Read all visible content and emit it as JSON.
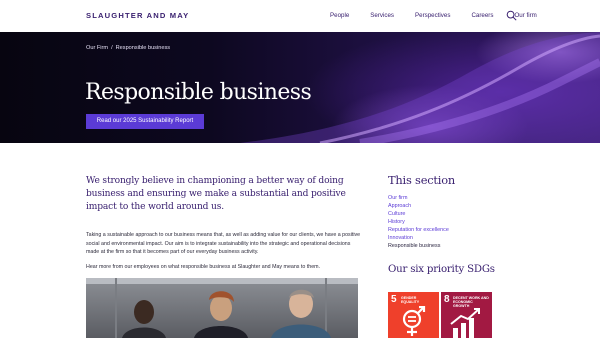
{
  "header": {
    "logo": "SLAUGHTER AND MAY",
    "nav": [
      "People",
      "Services",
      "Perspectives",
      "Careers",
      "Our firm"
    ]
  },
  "hero": {
    "breadcrumb": [
      "Our Firm",
      "Responsible business"
    ],
    "breadcrumb_separator": "/",
    "title": "Responsible business",
    "button_label": "Read our 2025 Sustainability Report"
  },
  "main": {
    "lead": "We strongly believe in championing a better way of doing business and ensuring we make a substantial and positive impact to the world around us.",
    "paragraph1": "Taking a sustainable approach to our business means that, as well as adding value for our clients, we have a positive social and environmental impact. Our aim is to integrate sustainability into the strategic and operational decisions made at the firm so that it becomes part of our everyday business activity.",
    "paragraph2": "Hear more from our employees on what responsible business at Slaughter and May means to them."
  },
  "sidebar": {
    "section_title": "This section",
    "links": [
      "Our firm",
      "Approach",
      "Culture",
      "History",
      "Reputation for excellence",
      "Innovation",
      "Responsible business"
    ],
    "current_link": "Responsible business",
    "sdg_title": "Our six priority SDGs",
    "sdgs": [
      {
        "number": "5",
        "label": "GENDER EQUALITY"
      },
      {
        "number": "8",
        "label": "DECENT WORK AND ECONOMIC GROWTH"
      }
    ]
  },
  "colors": {
    "brand": "#3a2170",
    "accent": "#5b3bd6",
    "sdg5": "#ef402b",
    "sdg8": "#a21942"
  },
  "icons": [
    "search-icon",
    "gender-equality-icon",
    "economic-growth-icon"
  ]
}
